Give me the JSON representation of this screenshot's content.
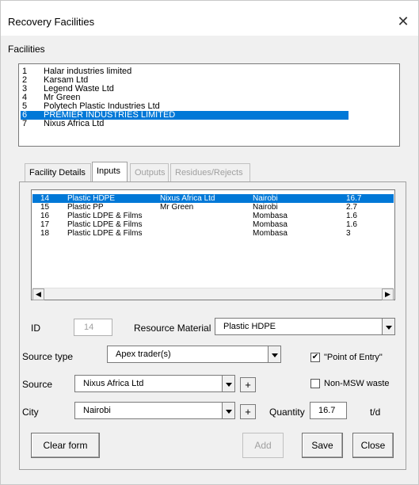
{
  "window": {
    "title": "Recovery Facilities",
    "close_glyph": "✕"
  },
  "facilities": {
    "label": "Facilities",
    "items": [
      {
        "num": "1",
        "name": "Halar industries limited"
      },
      {
        "num": "2",
        "name": "Karsam Ltd"
      },
      {
        "num": "3",
        "name": "Legend Waste Ltd"
      },
      {
        "num": "4",
        "name": "Mr Green"
      },
      {
        "num": "5",
        "name": "Polytech Plastic Industries Ltd"
      },
      {
        "num": "6",
        "name": "PREMIER INDUSTRIES LIMITED",
        "selected": true
      },
      {
        "num": "7",
        "name": "Nixus Africa Ltd"
      }
    ]
  },
  "tabs": [
    {
      "label": "Facility Details"
    },
    {
      "label": "Inputs",
      "active": true
    },
    {
      "label": "Outputs",
      "disabled": true
    },
    {
      "label": "Residues/Rejects",
      "disabled": true
    }
  ],
  "inputs_list": {
    "rows": [
      {
        "id": "14",
        "material": "Plastic HDPE",
        "source": "Nixus Africa Ltd",
        "city": "Nairobi",
        "qty": "16.7",
        "selected": true
      },
      {
        "id": "15",
        "material": "Plastic PP",
        "source": "Mr Green",
        "city": "Nairobi",
        "qty": "2.7"
      },
      {
        "id": "16",
        "material": "Plastic LDPE & Films",
        "source": "",
        "city": "Mombasa",
        "qty": "1.6"
      },
      {
        "id": "17",
        "material": "Plastic LDPE & Films",
        "source": "",
        "city": "Mombasa",
        "qty": "1.6"
      },
      {
        "id": "18",
        "material": "Plastic LDPE & Films",
        "source": "",
        "city": "Mombasa",
        "qty": "3"
      }
    ]
  },
  "form": {
    "id_label": "ID",
    "id_value": "14",
    "resource_label": "Resource Material",
    "resource_value": "Plastic HDPE",
    "source_type_label": "Source type",
    "source_type_value": "Apex trader(s)",
    "point_of_entry_label": "\"Point of Entry\"",
    "point_of_entry_checked": true,
    "source_label": "Source",
    "source_value": "Nixus Africa Ltd",
    "non_msw_label": "Non-MSW waste",
    "non_msw_checked": false,
    "city_label": "City",
    "city_value": "Nairobi",
    "quantity_label": "Quantity",
    "quantity_value": "16.7",
    "quantity_unit": "t/d",
    "plus_glyph": "+"
  },
  "buttons": {
    "clear": "Clear form",
    "add": "Add",
    "save": "Save",
    "close": "Close"
  },
  "check_glyph": "✔",
  "scroll": {
    "left_glyph": "◀",
    "right_glyph": "▶"
  }
}
